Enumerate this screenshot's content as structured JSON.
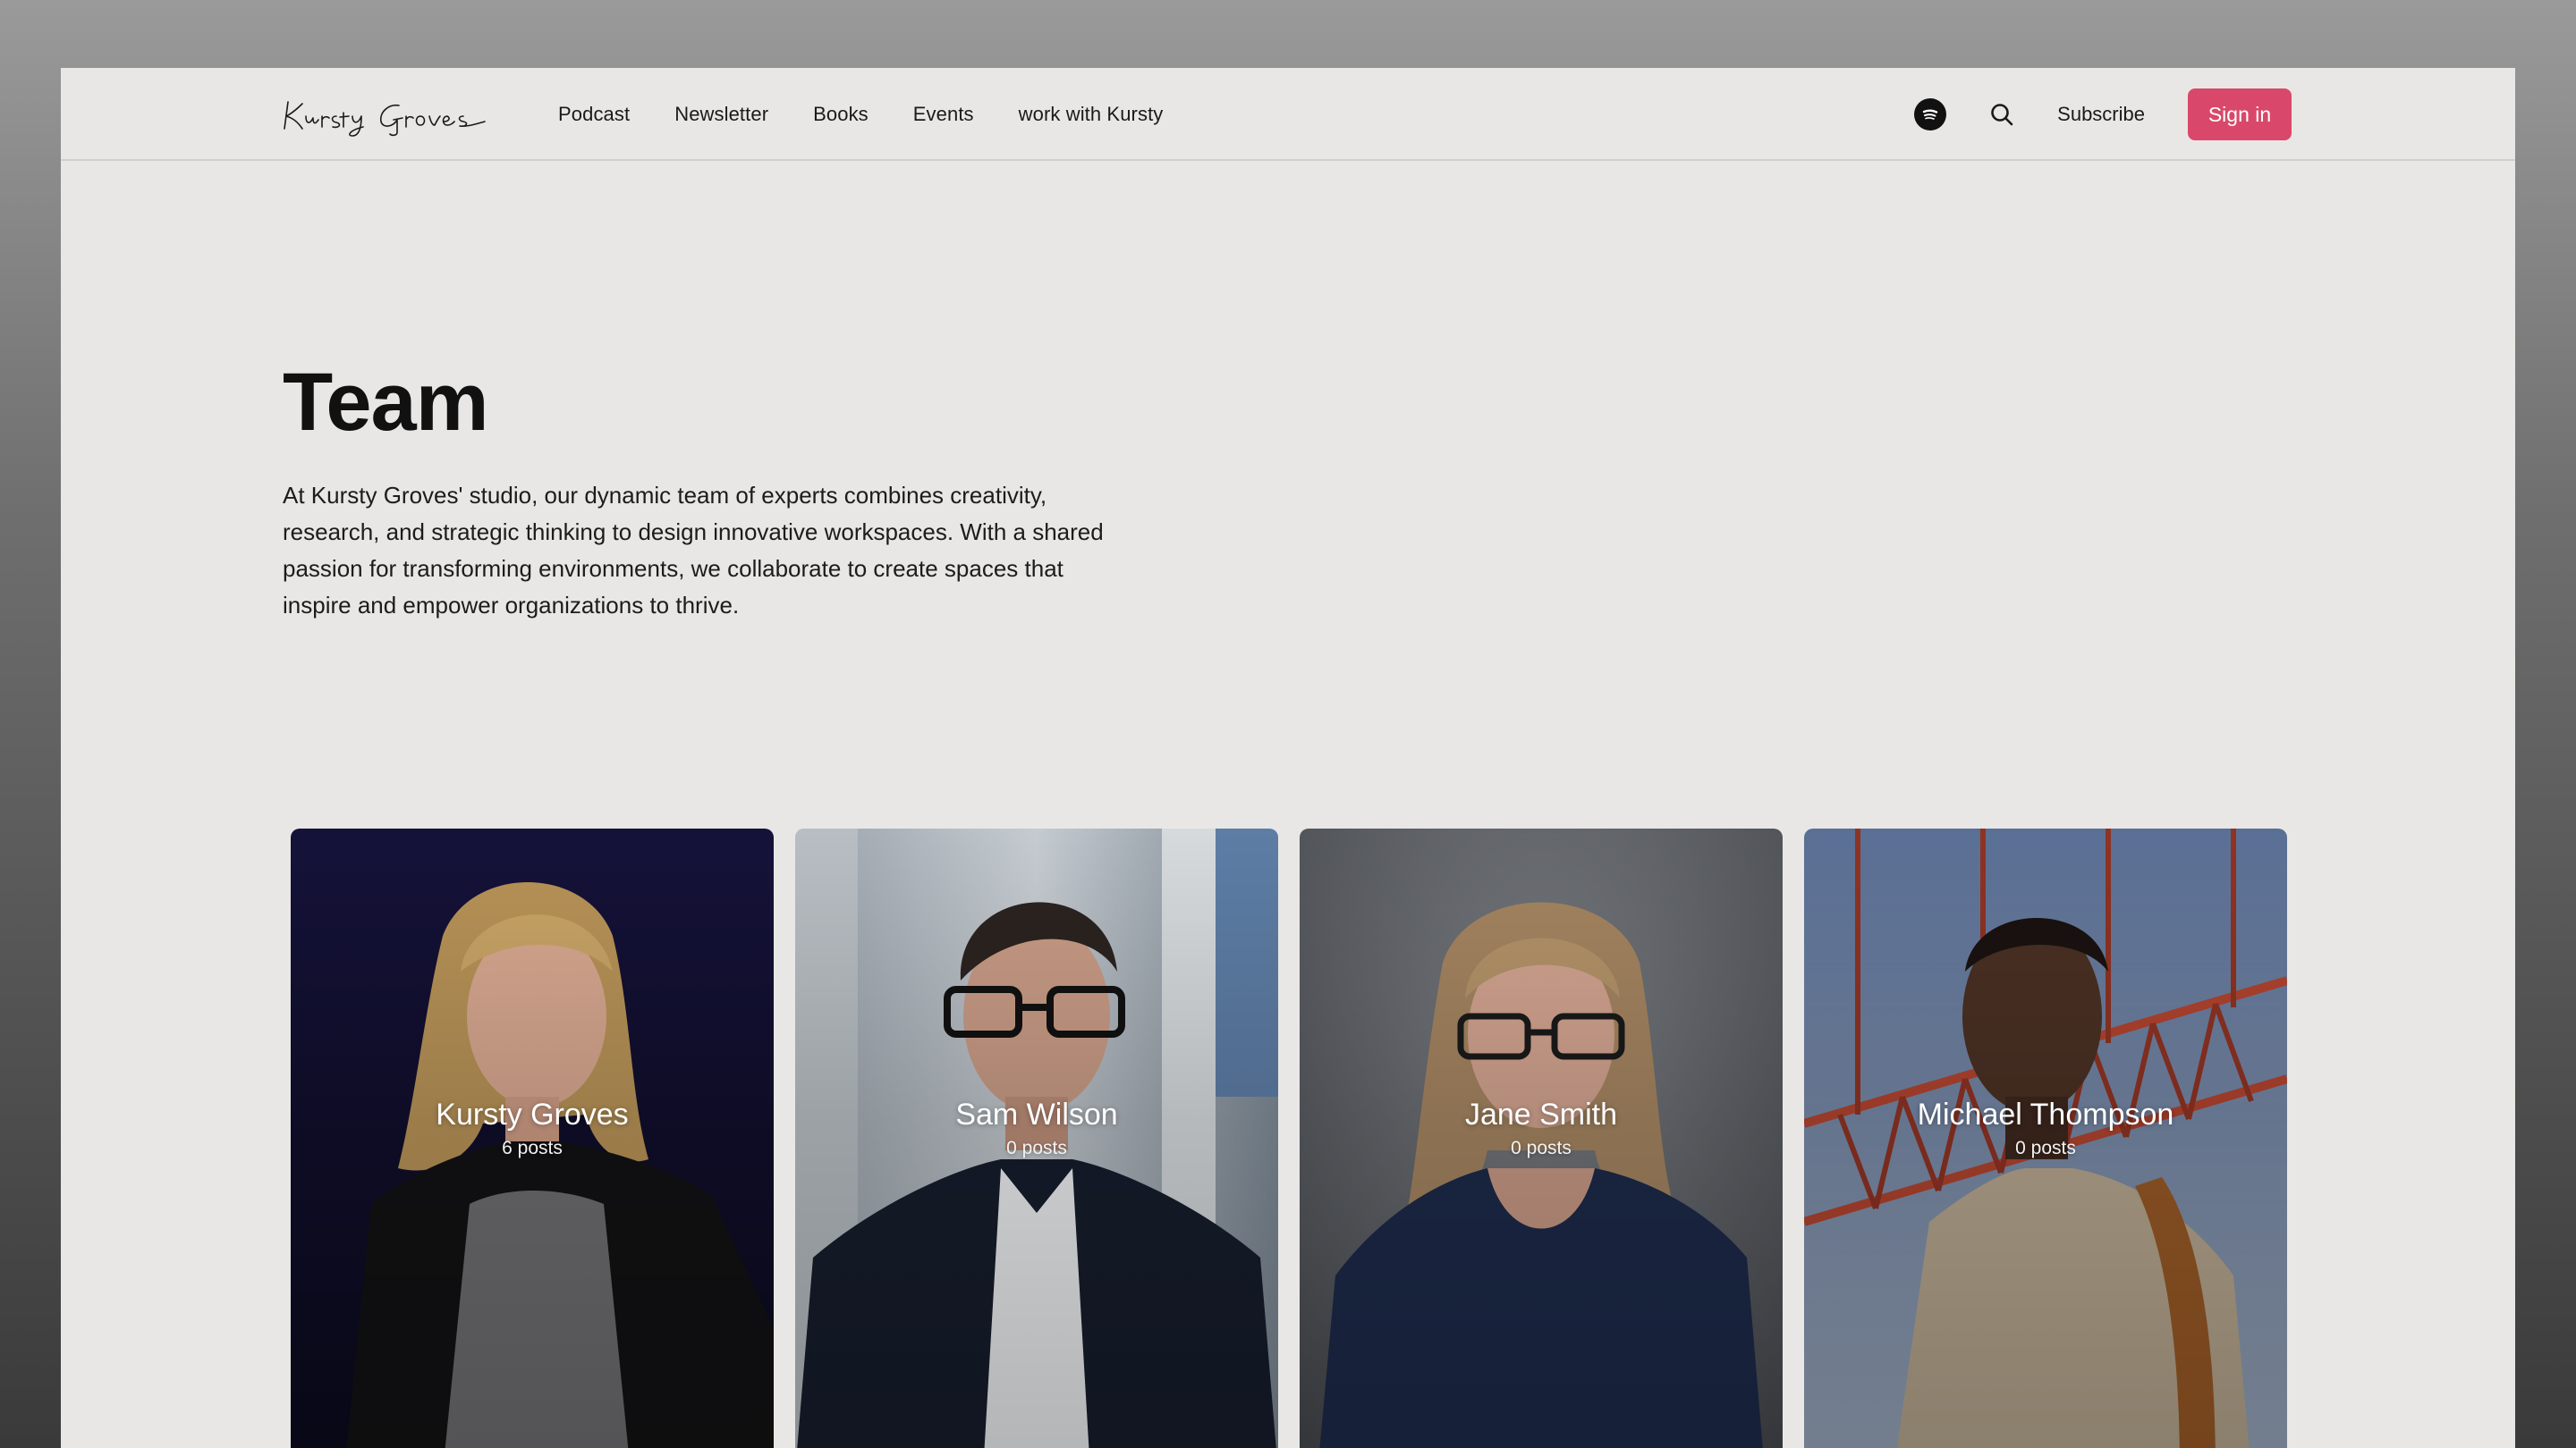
{
  "header": {
    "logo_text": "Kursty Groves",
    "nav": [
      {
        "label": "Podcast"
      },
      {
        "label": "Newsletter"
      },
      {
        "label": "Books"
      },
      {
        "label": "Events"
      },
      {
        "label": "work with Kursty"
      }
    ],
    "spotify_icon": "spotify-icon",
    "search_icon": "search-icon",
    "subscribe_label": "Subscribe",
    "signin_label": "Sign in"
  },
  "hero": {
    "title": "Team",
    "description": "At Kursty Groves' studio, our dynamic team of experts combines creativity, research, and strategic thinking to design innovative workspaces. With a shared passion for transforming environments, we collaborate to create spaces that inspire and empower organizations to thrive."
  },
  "team": [
    {
      "name": "Kursty Groves",
      "posts": "6 posts"
    },
    {
      "name": "Sam Wilson",
      "posts": "0 posts"
    },
    {
      "name": "Jane Smith",
      "posts": "0 posts"
    },
    {
      "name": "Michael Thompson",
      "posts": "0 posts"
    }
  ],
  "colors": {
    "accent": "#d9486a",
    "background": "#e8e7e5",
    "text": "#1a1a1a"
  }
}
